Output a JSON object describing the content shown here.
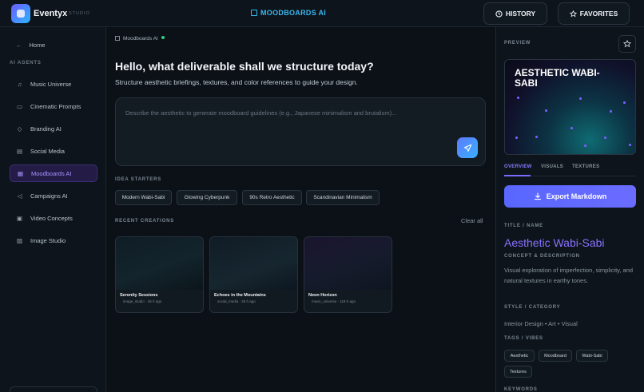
{
  "topbar": {
    "brand": "Eventyx",
    "brand_sub": "STUDIO",
    "center_title": "MOODBOARDS AI",
    "history_label": "HISTORY",
    "favorites_label": "FAVORITES"
  },
  "sidebar": {
    "home_label": "Home",
    "section_label": "AI AGENTS",
    "items": [
      {
        "label": "Music Universe",
        "icon": "music-note-icon"
      },
      {
        "label": "Cinematic Prompts",
        "icon": "video-camera-icon"
      },
      {
        "label": "Branding AI",
        "icon": "diamond-icon"
      },
      {
        "label": "Social Media",
        "icon": "chat-icon"
      },
      {
        "label": "Moodboards AI",
        "icon": "grid-icon",
        "active": true
      },
      {
        "label": "Campaigns AI",
        "icon": "megaphone-icon"
      },
      {
        "label": "Video Concepts",
        "icon": "film-icon"
      },
      {
        "label": "Image Studio",
        "icon": "image-icon"
      }
    ]
  },
  "main": {
    "breadcrumb": "Moodboards AI",
    "headline": "Hello, what deliverable shall we structure today?",
    "subline": "Structure aesthetic briefings, textures, and color references to guide your design.",
    "prompt_placeholder": "Describe the aesthetic to generate moodboard guidelines (e.g., Japanese minimalism and brutalism)...",
    "idea_starters_label": "IDEA STARTERS",
    "idea_starters": [
      "Modern Wabi-Sabi",
      "Glowing Cyberpunk",
      "90s Retro Aesthetic",
      "Scandinavian Minimalism"
    ],
    "recent_label": "RECENT CREATIONS",
    "clear_all": "Clear all",
    "recent": [
      {
        "title": "Serenity Sessions",
        "meta": "image_studio · 26 h ago"
      },
      {
        "title": "Echoes in the Mountains",
        "meta": "social_media · 26 h ago"
      },
      {
        "title": "Neon Horizon",
        "meta": "music_universe · 119 h ago"
      }
    ]
  },
  "right": {
    "preview_label": "PREVIEW",
    "preview_title": "AESTHETIC WABI-SABI",
    "tabs": [
      "OVERVIEW",
      "VISUALS",
      "TEXTURES"
    ],
    "export_label": "Export Markdown",
    "title_label": "TITLE / NAME",
    "title_value": "Aesthetic Wabi-Sabi",
    "concept_label": "CONCEPT & DESCRIPTION",
    "concept_value": "Visual exploration of imperfection, simplicity, and natural textures in earthy tones.",
    "style_label": "STYLE / CATEGORY",
    "style_value": "Interior Design • Art • Visual",
    "tags_label": "TAGS / VIBES",
    "tags": [
      "Aesthetic",
      "Moodboard",
      "Wabi-Sabi",
      "Textures"
    ],
    "keywords_label": "KEYWORDS"
  },
  "colors": {
    "accent": "#7b6bff",
    "brand_blue": "#39b7ef",
    "status_online": "#2fd17f"
  }
}
